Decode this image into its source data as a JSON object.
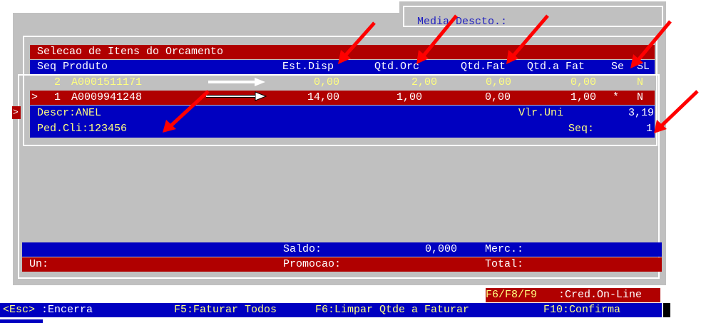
{
  "header": {
    "media_descto_label": "Media Descto.:"
  },
  "selection": {
    "title": "Selecao de Itens do Orcamento",
    "columns": [
      "Seq Produto",
      "Est.Disp",
      "Qtd.Orc",
      "Qtd.Fat",
      "Qtd.a Fat",
      "Se",
      "SL"
    ],
    "rows": [
      {
        "seq": "2",
        "produto": "A0001511171",
        "est_disp": "0,00",
        "qtd_orc": "2,00",
        "qtd_fat": "0,00",
        "qtd_a_fat": "0,00",
        "se": "",
        "sl": "N"
      },
      {
        "marker": ">",
        "seq": "1",
        "produto": "A0009941248",
        "est_disp": "14,00",
        "qtd_orc": "1,00",
        "qtd_fat": "0,00",
        "qtd_a_fat": "1,00",
        "se": "*",
        "sl": "N"
      }
    ]
  },
  "detail": {
    "side_marker": ">",
    "descr": "Descr:ANEL",
    "vlr_uni_label": "Vlr.Uni",
    "vlr_uni_value": "3,19",
    "ped_cli": "Ped.Cli:123456",
    "seq_label": "Seq:",
    "seq_value": "1"
  },
  "totals": {
    "saldo_label": "Saldo:",
    "saldo_value": "0,000",
    "merc_label": "Merc.:",
    "un_label": "Un:",
    "promocao_label": "Promocao:",
    "total_label": "Total:"
  },
  "footer": {
    "credit_key": "F6/F8/F9",
    "credit_label": ":Cred.On-Line",
    "esc_key": "<Esc>",
    "esc_label": ":Encerra",
    "f5": "F5:Faturar Todos",
    "f6": "F6:Limpar Qtde a Faturar",
    "f10": "F10:Confirma"
  },
  "colors": {
    "red_bar": "#b00000",
    "blue_bar": "#0000c0",
    "window_gray": "#c0c0c0",
    "text_yellow": "#ffff80",
    "annotation_arrow": "#ff0000"
  }
}
